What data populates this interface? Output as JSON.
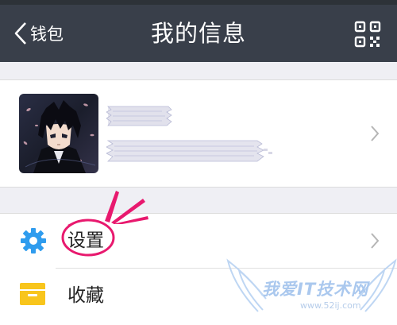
{
  "navbar": {
    "back_label": "钱包",
    "title": "我的信息",
    "background": "#393f4a"
  },
  "profile": {
    "avatar_icon": "anime-avatar",
    "name_redacted": true,
    "id_redacted": true
  },
  "menu": [
    {
      "label": "设置",
      "icon": "gear-icon",
      "icon_color": "#2f9cee",
      "highlighted": true
    },
    {
      "label": "收藏",
      "icon": "favorites-box-icon",
      "icon_color": "#f8c51c"
    }
  ],
  "annotation": {
    "color": "#e8196e"
  },
  "watermark": {
    "text": "我爱IT技术网",
    "url": "www.52ij.com"
  }
}
